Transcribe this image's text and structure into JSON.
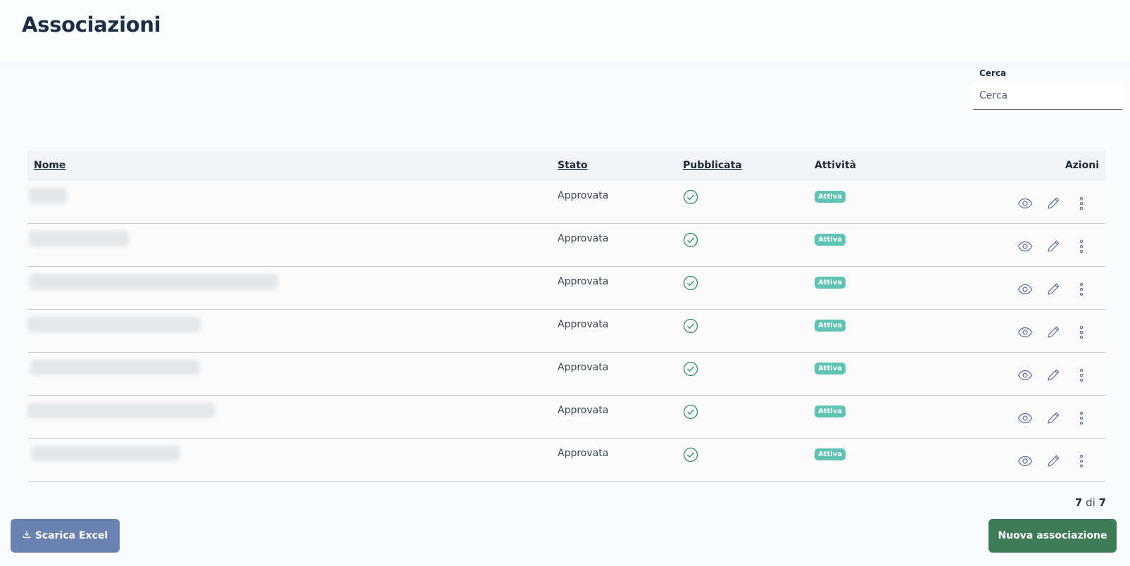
{
  "page": {
    "title": "Associazioni"
  },
  "search": {
    "label": "Cerca",
    "placeholder": "Cerca"
  },
  "table": {
    "columns": {
      "nome": "Nome",
      "stato": "Stato",
      "pubblicata": "Pubblicata",
      "attivita": "Attività",
      "azioni": "Azioni"
    },
    "rows": [
      {
        "stato": "Approvata",
        "pubblicata": true,
        "attivita": "Attiva"
      },
      {
        "stato": "Approvata",
        "pubblicata": true,
        "attivita": "Attiva"
      },
      {
        "stato": "Approvata",
        "pubblicata": true,
        "attivita": "Attiva"
      },
      {
        "stato": "Approvata",
        "pubblicata": true,
        "attivita": "Attiva"
      },
      {
        "stato": "Approvata",
        "pubblicata": true,
        "attivita": "Attiva"
      },
      {
        "stato": "Approvata",
        "pubblicata": true,
        "attivita": "Attiva"
      },
      {
        "stato": "Approvata",
        "pubblicata": true,
        "attivita": "Attiva"
      }
    ]
  },
  "pagination": {
    "shown": "7",
    "separator": "di",
    "total": "7"
  },
  "buttons": {
    "download_excel": "Scarica Excel",
    "new_association": "Nuova associazione"
  },
  "icons": {
    "view": "eye-icon",
    "edit": "pencil-icon",
    "more": "more-vertical-icon",
    "published": "check-circle-icon",
    "download": "download-icon"
  },
  "colors": {
    "title": "#1c2e46",
    "badge": "#5fc3b3",
    "check": "#2f8a68",
    "excel_button": "#6a82b0",
    "new_button": "#3f7b57",
    "action_icon": "#5a6f9c"
  }
}
